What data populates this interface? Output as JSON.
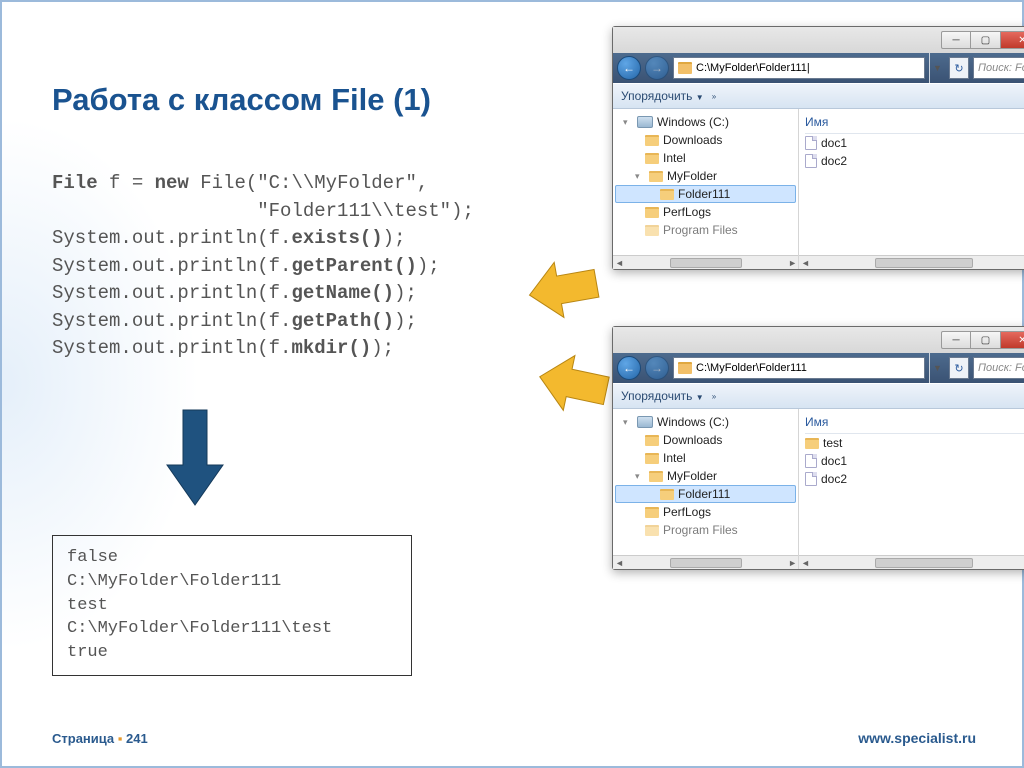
{
  "title": "Работа с классом File (1)",
  "code": {
    "l1a": "File",
    "l1b": " f = ",
    "l1c": "new",
    "l1d": " File(\"C:\\\\MyFolder\",",
    "l2": "                  \"Folder111\\\\test\");",
    "l3a": "System.out.println(f.",
    "l3b": "exists()",
    "l3c": ");",
    "l4a": "System.out.println(f.",
    "l4b": "getParent()",
    "l4c": ");",
    "l5a": "System.out.println(f.",
    "l5b": "getName()",
    "l5c": ");",
    "l6a": "System.out.println(f.",
    "l6b": "getPath()",
    "l6c": ");",
    "l7a": "System.out.println(f.",
    "l7b": "mkdir()",
    "l7c": ");"
  },
  "output": "false\nC:\\MyFolder\\Folder111\ntest\nC:\\MyFolder\\Folder111\\test\ntrue",
  "footer": {
    "page_label": "Страница",
    "page_num": "241",
    "url": "www.specialist.ru"
  },
  "explorer": {
    "path1": "C:\\MyFolder\\Folder111|",
    "path2": "C:\\MyFolder\\Folder111",
    "search": "Поиск: Fo",
    "organize": "Упорядочить",
    "col": "Имя",
    "tree": {
      "root": "Windows (C:)",
      "items": [
        "Downloads",
        "Intel",
        "MyFolder",
        "Folder111",
        "PerfLogs",
        "Program Files"
      ]
    },
    "files_top": [
      "doc1",
      "doc2"
    ],
    "files_bot": [
      {
        "type": "folder",
        "name": "test"
      },
      {
        "type": "doc",
        "name": "doc1"
      },
      {
        "type": "doc",
        "name": "doc2"
      }
    ]
  }
}
